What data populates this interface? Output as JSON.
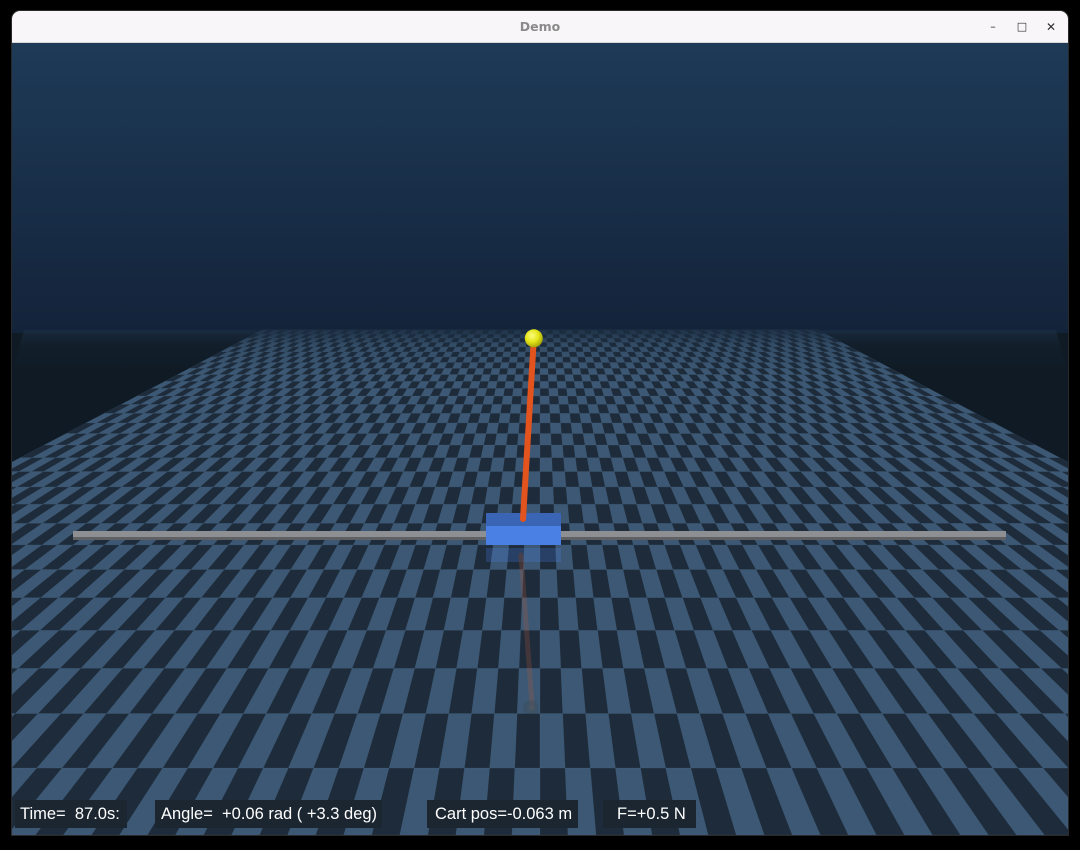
{
  "window": {
    "title": "Demo",
    "minimize_glyph": "–",
    "maximize_glyph": "□",
    "close_glyph": "✕"
  },
  "hud": {
    "time_label": "Time=",
    "time_value": "87.0s:",
    "angle_label": "Angle=",
    "angle_value": "+0.06 rad ( +3.3 deg)",
    "cart_label": "Cart pos=",
    "cart_value": "-0.063 m",
    "force_label": "F=",
    "force_value": "+0.5 N"
  },
  "scene": {
    "sky_top_color": "#1e3a57",
    "sky_bottom_color": "#13233a",
    "floor_dark_color": "#1d2b3b",
    "floor_light_color": "#3c5874",
    "rail_color": "#8d8f92",
    "cart_color": "#4a7fe4",
    "pole_color": "#e2531e",
    "bob_color": "#e6e61a",
    "pole_angle_rad": 0.06
  }
}
